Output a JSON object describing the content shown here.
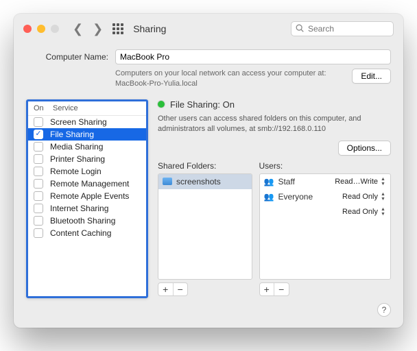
{
  "titlebar": {
    "title": "Sharing",
    "search_placeholder": "Search"
  },
  "computer_name": {
    "label": "Computer Name:",
    "value": "MacBook Pro",
    "help": "Computers on your local network can access your computer at: MacBook-Pro-Yulia.local",
    "edit": "Edit..."
  },
  "services": {
    "header_on": "On",
    "header_service": "Service",
    "items": [
      {
        "label": "Screen Sharing",
        "checked": false,
        "selected": false
      },
      {
        "label": "File Sharing",
        "checked": true,
        "selected": true
      },
      {
        "label": "Media Sharing",
        "checked": false,
        "selected": false
      },
      {
        "label": "Printer Sharing",
        "checked": false,
        "selected": false
      },
      {
        "label": "Remote Login",
        "checked": false,
        "selected": false
      },
      {
        "label": "Remote Management",
        "checked": false,
        "selected": false
      },
      {
        "label": "Remote Apple Events",
        "checked": false,
        "selected": false
      },
      {
        "label": "Internet Sharing",
        "checked": false,
        "selected": false
      },
      {
        "label": "Bluetooth Sharing",
        "checked": false,
        "selected": false
      },
      {
        "label": "Content Caching",
        "checked": false,
        "selected": false
      }
    ]
  },
  "status": {
    "title": "File Sharing: On",
    "desc": "Other users can access shared folders on this computer, and administrators all volumes, at smb://192.168.0.110",
    "options": "Options..."
  },
  "shared_folders": {
    "title": "Shared Folders:",
    "items": [
      {
        "name": "screenshots",
        "selected": true
      }
    ]
  },
  "users": {
    "title": "Users:",
    "items": [
      {
        "name": "Staff",
        "perm": "Read…Write",
        "icon": "group"
      },
      {
        "name": "Everyone",
        "perm": "Read Only",
        "icon": "group"
      }
    ],
    "extra_perm_rows": [
      "Read Only"
    ]
  },
  "buttons": {
    "plus": "+",
    "minus": "−",
    "help": "?"
  }
}
